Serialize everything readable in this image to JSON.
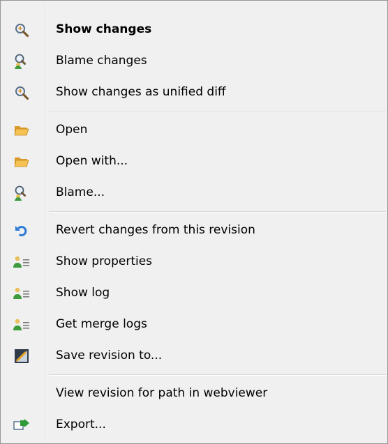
{
  "menu": {
    "groups": [
      {
        "items": [
          {
            "label": "Show changes",
            "icon": "magnifier-icon",
            "bold": true
          },
          {
            "label": "Blame changes",
            "icon": "blame-icon"
          },
          {
            "label": "Show changes as unified diff",
            "icon": "magnifier-icon"
          }
        ]
      },
      {
        "items": [
          {
            "label": "Open",
            "icon": "folder-open-icon"
          },
          {
            "label": "Open with...",
            "icon": "folder-open-icon"
          },
          {
            "label": "Blame...",
            "icon": "blame-icon"
          }
        ]
      },
      {
        "items": [
          {
            "label": "Revert changes from this revision",
            "icon": "revert-icon"
          },
          {
            "label": "Show properties",
            "icon": "properties-icon"
          },
          {
            "label": "Show log",
            "icon": "properties-icon"
          },
          {
            "label": "Get merge logs",
            "icon": "properties-icon"
          },
          {
            "label": "Save revision to...",
            "icon": "save-revision-icon"
          }
        ]
      },
      {
        "items": [
          {
            "label": "View revision for path in webviewer",
            "icon": ""
          },
          {
            "label": "Export...",
            "icon": "export-icon"
          }
        ]
      }
    ]
  },
  "colors": {
    "menu_background": "#f0f0f0",
    "border": "#979797",
    "separator": "#d6d6d6",
    "text": "#000000"
  }
}
